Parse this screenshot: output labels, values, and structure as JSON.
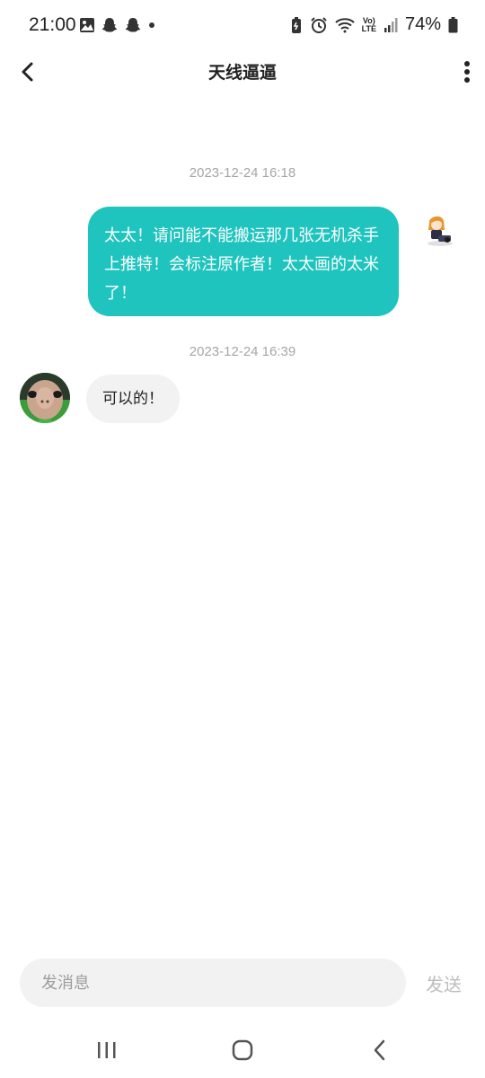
{
  "status_bar": {
    "time": "21:00",
    "battery": "74%",
    "network_top": "Vo)",
    "network_bottom": "LTE"
  },
  "header": {
    "title": "天线逼逼"
  },
  "messages": [
    {
      "timestamp": "2023-12-24 16:18",
      "direction": "outgoing",
      "text": "太太！请问能不能搬运那几张无机杀手上推特！会标注原作者！太太画的太米了！"
    },
    {
      "timestamp": "2023-12-24 16:39",
      "direction": "incoming",
      "text": "可以的！"
    }
  ],
  "input": {
    "placeholder": "发消息",
    "value": ""
  },
  "send_label": "发送",
  "colors": {
    "outgoing_bubble": "#1ec4bd",
    "incoming_bubble": "#f2f2f2",
    "timestamp": "#a6a6a6",
    "send_disabled": "#bdbdbd"
  }
}
